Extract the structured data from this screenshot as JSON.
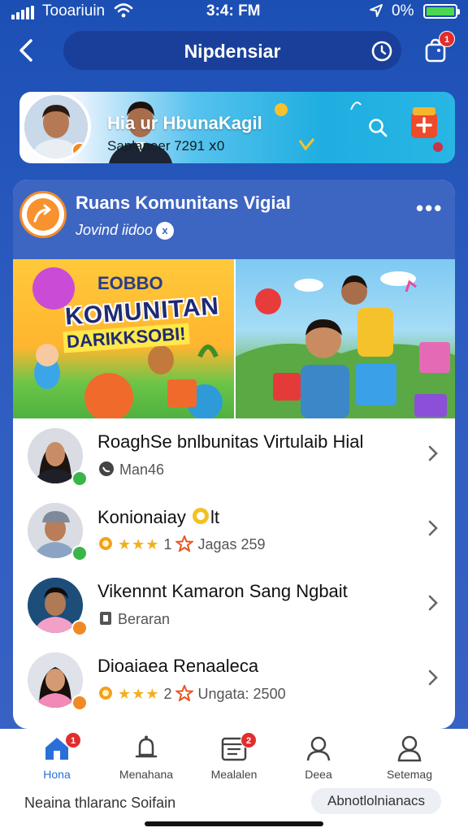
{
  "status_bar": {
    "carrier": "Tooariuin",
    "time": "3:4: FM",
    "battery": "0%",
    "battery_level": 1.0
  },
  "header": {
    "title": "Nipdensiar",
    "bag_badge": "1"
  },
  "banner": {
    "title": "Hia   ur HbunaKagil",
    "subtitle": "Saplanoer 7291 ⅹ0"
  },
  "group": {
    "title": "Ruans Komunitans Vigial",
    "subtitle": "Jovind iidoo",
    "subtitle_icon": "x"
  },
  "promo": {
    "tag": "EOBBO",
    "headline": "KOMUNITAN",
    "subline": "DARIKKSOBI!"
  },
  "list": [
    {
      "title": "RoaghSe bnlbunitas Virtulaib Hial",
      "meta_text": "Man46",
      "meta_icon": "phone-icon",
      "status_color": "#3bb54a"
    },
    {
      "title": "Konionaiay",
      "rating_stars": "★★★",
      "rating_value": "1",
      "meta_text": "Jagas 259",
      "status_color": "#3bb54a"
    },
    {
      "title": "Vikennnt Kamaron Sang Ngbait",
      "meta_text": "Beraran",
      "meta_icon": "bookmark-icon",
      "status_color": "#f08a24"
    },
    {
      "title": "Dioaiaea Renaaleca",
      "rating_stars": "★★★",
      "rating_value": "2",
      "meta_text": "Ungata: 2500",
      "status_color": "#f08a24"
    }
  ],
  "tabbar": {
    "tabs": [
      {
        "label": "Hona",
        "badge": "1",
        "icon": "home-icon"
      },
      {
        "label": "Menahana",
        "icon": "bell-icon"
      },
      {
        "label": "Mealalen",
        "badge": "2",
        "icon": "calendar-icon"
      },
      {
        "label": "Deea",
        "icon": "profile-icon"
      },
      {
        "label": "Setemag",
        "icon": "user-settings-icon"
      }
    ]
  },
  "footer": {
    "left_text": "Neaina thlaranc Soifain",
    "pill_text": "Abnotlolnianacs"
  },
  "colors": {
    "brand": "#1c4fb4",
    "active_tab": "#2a6fd8",
    "accent_orange": "#f7922e",
    "badge_red": "#e22d2d"
  }
}
